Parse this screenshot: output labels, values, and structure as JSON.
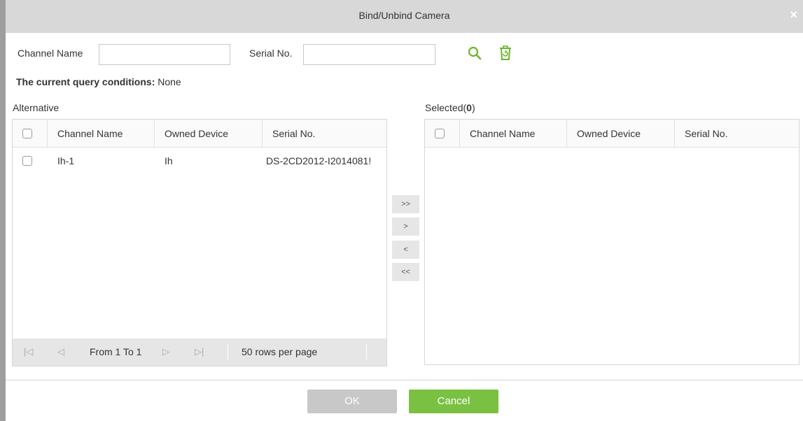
{
  "dialog": {
    "title": "Bind/Unbind Camera",
    "close_glyph": "×"
  },
  "search": {
    "channel_name_label": "Channel Name",
    "channel_name_value": "",
    "serial_no_label": "Serial No.",
    "serial_no_value": "",
    "search_icon": "search-icon",
    "clear_icon": "clear-icon"
  },
  "query": {
    "label": "The current query conditions:",
    "value": "None"
  },
  "alternative": {
    "title": "Alternative",
    "columns": [
      "Channel Name",
      "Owned Device",
      "Serial No."
    ],
    "rows": [
      {
        "channel_name": "Ih-1",
        "owned_device": "Ih",
        "serial_no": "DS-2CD2012-I2014081!"
      }
    ],
    "pager": {
      "range": "From 1 To 1",
      "rows_per_page": "50 rows per page"
    }
  },
  "selected": {
    "title_prefix": "Selected(",
    "count": "0",
    "title_suffix": ")",
    "columns": [
      "Channel Name",
      "Owned Device",
      "Serial No."
    ]
  },
  "move_buttons": {
    "all_right": ">>",
    "right": ">",
    "left": "<",
    "all_left": "<<"
  },
  "footer": {
    "ok_label": "OK",
    "cancel_label": "Cancel"
  },
  "colors": {
    "accent_green": "#7ac143",
    "icon_green": "#6cb52d",
    "ok_disabled": "#c8c8c8"
  }
}
